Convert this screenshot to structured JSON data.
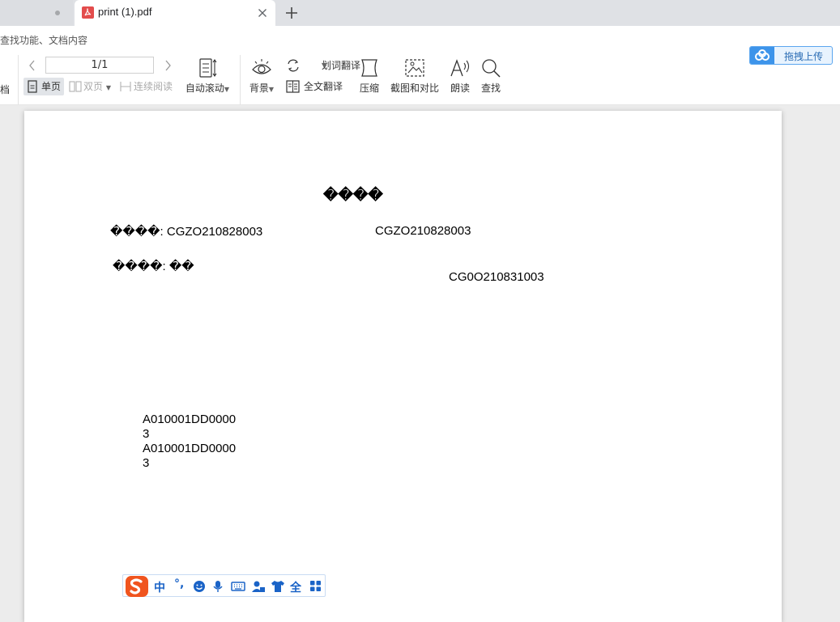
{
  "tabs": {
    "active_title": "print (1).pdf"
  },
  "toolbar": {
    "search_hint": "查找功能、文档内容",
    "left_cut_label": "档",
    "page_indicator": "1/1",
    "modes": {
      "single": "单页",
      "double": "双页",
      "continuous": "连续阅读"
    },
    "auto_scroll": "自动滚动",
    "background": "背景",
    "word_translate": "划词翻译",
    "full_translate": "全文翻译",
    "compress": "压缩",
    "screenshot_compare": "截图和对比",
    "read_aloud": "朗读",
    "find": "查找",
    "upload_label": "拖拽上传"
  },
  "document": {
    "title": "����",
    "field1_label": "����: CGZO210828003",
    "field1_value_right": "CGZO210828003",
    "field2_label": "����: ��",
    "field2_value_right": "CG0O210831003",
    "line_a": "A010001DD0000",
    "line_b": "3",
    "line_c": "A010001DD0000",
    "line_d": "3"
  },
  "ime": {
    "chinese_mode": "中",
    "punct": "°,",
    "fullwidth": "全"
  },
  "colors": {
    "accent": "#3d94ea",
    "pdf_icon": "#e34c4c",
    "ime_blue": "#1a63c7",
    "sogou_orange": "#f0541e"
  }
}
